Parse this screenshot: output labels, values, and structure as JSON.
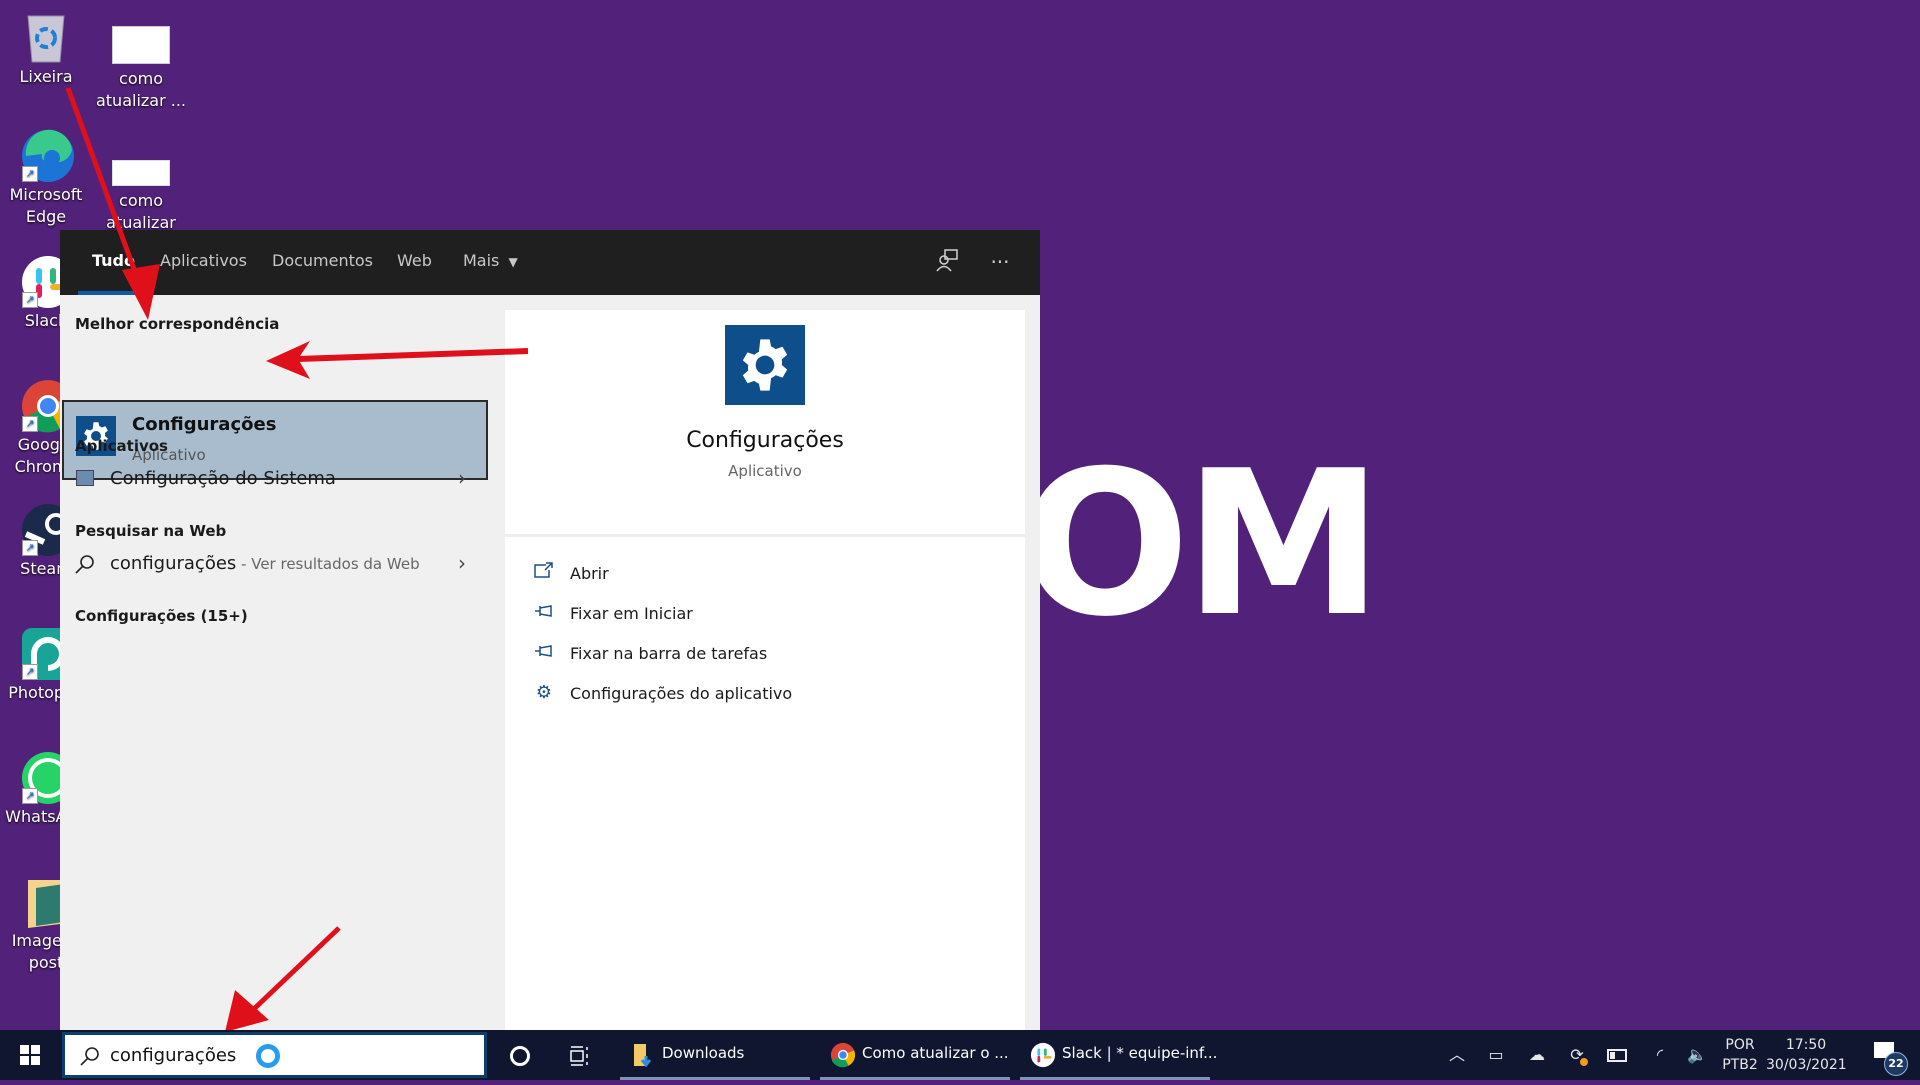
{
  "desktop": {
    "background_color": "#52227a",
    "logo_partial_text": "OM",
    "icons": [
      {
        "label": "Lixeira",
        "icon": "recycle-bin-icon"
      },
      {
        "label": "como atualizar ...",
        "icon": "document-thumbnail-icon"
      },
      {
        "label": "Microsoft Edge",
        "icon": "edge-icon"
      },
      {
        "label": "como atualizar",
        "icon": "document-thumbnail-icon"
      },
      {
        "label": "Slack",
        "icon": "slack-icon"
      },
      {
        "label": "Google Chrome",
        "icon": "chrome-icon"
      },
      {
        "label": "Steam",
        "icon": "steam-icon"
      },
      {
        "label": "Photopea",
        "icon": "photopea-icon"
      },
      {
        "label": "WhatsApp",
        "icon": "whatsapp-icon"
      },
      {
        "label": "Imagens post",
        "icon": "folder-icon"
      }
    ]
  },
  "search_popup": {
    "tabs": [
      {
        "label": "Tudo",
        "active": true
      },
      {
        "label": "Aplicativos",
        "active": false
      },
      {
        "label": "Documentos",
        "active": false
      },
      {
        "label": "Web",
        "active": false
      },
      {
        "label": "Mais",
        "active": false
      }
    ],
    "header_icons": [
      "feedback-icon",
      "more-options-icon"
    ],
    "best_match": {
      "section_title": "Melhor correspondência",
      "title": "Configurações",
      "subtitle": "Aplicativo"
    },
    "apps": {
      "section_title": "Aplicativos",
      "items": [
        {
          "label": "Configuração do Sistema"
        }
      ]
    },
    "web": {
      "section_title": "Pesquisar na Web",
      "query": "configurações",
      "suffix": " - Ver resultados da Web"
    },
    "settings": {
      "section_title": "Configurações (15+)"
    },
    "detail": {
      "title": "Configurações",
      "subtitle": "Aplicativo",
      "actions": [
        {
          "label": "Abrir",
          "icon": "open-icon"
        },
        {
          "label": "Fixar em Iniciar",
          "icon": "pin-icon"
        },
        {
          "label": "Fixar na barra de tarefas",
          "icon": "pin-icon"
        },
        {
          "label": "Configurações do aplicativo",
          "icon": "gear-icon"
        }
      ]
    }
  },
  "taskbar": {
    "search_value": "configurações",
    "apps": [
      {
        "label": "Downloads",
        "icon": "folder-icon"
      },
      {
        "label": "Como atualizar o ...",
        "icon": "chrome-icon"
      },
      {
        "label": "Slack | * equipe-inf...",
        "icon": "slack-icon"
      }
    ],
    "language": {
      "line1": "POR",
      "line2": "PTB2"
    },
    "time": "17:50",
    "date": "30/03/2021",
    "notifications_count": "22"
  }
}
